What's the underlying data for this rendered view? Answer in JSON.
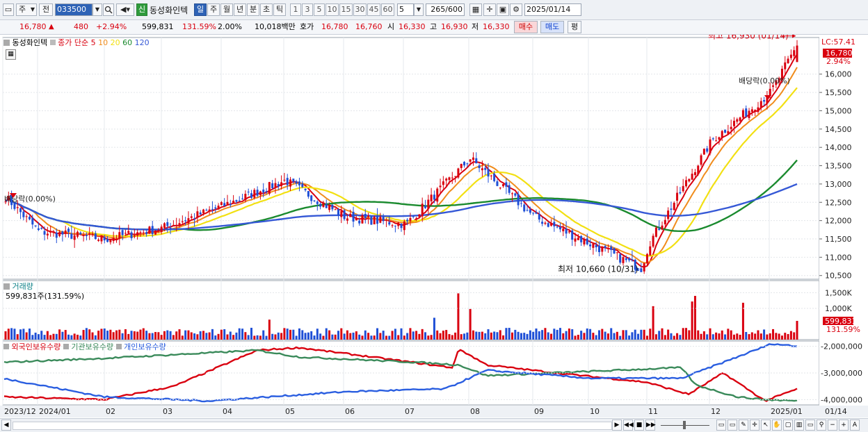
{
  "toolbar": {
    "market_select": "주",
    "prev_label": "전",
    "code": "033500",
    "new_badge": "신",
    "stock_name": "동성화인텍",
    "periods": [
      "일",
      "주",
      "월",
      "년",
      "분",
      "초",
      "틱"
    ],
    "active_period": "일",
    "intervals": [
      "1",
      "3",
      "5",
      "10",
      "15",
      "30",
      "45",
      "60"
    ],
    "interval_value": "5",
    "count_value": "265",
    "count_total": "/600",
    "date": "2025/01/14"
  },
  "quote": {
    "price": "16,780",
    "change_arrow": "▲",
    "change": "480",
    "change_pct": "+2.94%",
    "volume": "599,831",
    "volume_ratio": "131.59%",
    "turnover_pct": "2.00%",
    "amount": "10,018백만",
    "hoga_label": "호가",
    "ask": "16,780",
    "bid": "16,760",
    "open_label": "시",
    "open": "16,330",
    "high_label": "고",
    "high": "16,930",
    "low_label": "저",
    "low": "16,330",
    "buy_button": "매수",
    "sell_button": "매도",
    "eval_button": "평"
  },
  "price_panel": {
    "legend_name": "동성화인텍",
    "legend_ma_title": "종가 단순",
    "legend_ma_periods": [
      "5",
      "10",
      "20",
      "60",
      "120"
    ],
    "top_right_label": "LC:57.41",
    "price_tag": "16,780",
    "pct_tag": "2.94%",
    "max_annotation": "최고 16,930 (01/14)",
    "min_annotation": "최저 10,660 (10/31)",
    "dividend_right": "배당락(0.00%)",
    "dividend_left": "배당락(0.00%)",
    "y_ticks": [
      "16,000",
      "15,500",
      "15,000",
      "14,500",
      "14,000",
      "13,500",
      "13,000",
      "12,500",
      "12,000",
      "11,500",
      "11,000",
      "10,500"
    ]
  },
  "volume_panel": {
    "title": "거래량",
    "value_line": "599,831주(131.59%)",
    "y_ticks": [
      "1,500K",
      "1,000K"
    ],
    "tag_value": "599,831",
    "tag_pct": "131.59%"
  },
  "holdings_panel": {
    "legend": [
      "외국인보유수량",
      "기관보유수량",
      "개인보유수량"
    ],
    "y_ticks": [
      "-2,000,000",
      "-3,000,000",
      "-4,000,000"
    ]
  },
  "x_axis": {
    "labels": [
      "2023/12",
      "2024/01",
      "02",
      "03",
      "04",
      "05",
      "06",
      "07",
      "08",
      "09",
      "10",
      "11",
      "12",
      "2025/01",
      "01/14"
    ]
  },
  "colors": {
    "up": "#d9000f",
    "down": "#1f4fd6",
    "ma5": "#d9000f",
    "ma10": "#f08c1c",
    "ma20": "#f2e012",
    "ma60": "#1a8a2e",
    "ma120": "#3558d6",
    "foreign": "#d9000f",
    "institution": "#3a8a5a",
    "individual": "#2a5ee0"
  },
  "chart_data": {
    "type": "candlestick",
    "period": "daily",
    "price_range": [
      10400,
      17000
    ],
    "anchor_closes": [
      {
        "date": "2023/12",
        "close": 12650
      },
      {
        "date": "2024/01",
        "close": 11700
      },
      {
        "date": "02",
        "close": 11500
      },
      {
        "date": "03",
        "close": 11800
      },
      {
        "date": "04",
        "close": 12400
      },
      {
        "date": "05",
        "close": 13100
      },
      {
        "date": "06",
        "close": 12100
      },
      {
        "date": "07",
        "close": 11900
      },
      {
        "date": "08",
        "close": 13700
      },
      {
        "date": "09",
        "close": 12100
      },
      {
        "date": "10/31",
        "close": 10700
      },
      {
        "date": "11",
        "close": 11400
      },
      {
        "date": "12",
        "close": 14200
      },
      {
        "date": "2025/01",
        "close": 15500
      },
      {
        "date": "01/14",
        "close": 16780
      }
    ],
    "last_bar": {
      "open": 16330,
      "high": 16930,
      "low": 16330,
      "close": 16780,
      "volume": 599831
    },
    "period_high": {
      "value": 16930,
      "date": "01/14"
    },
    "period_low": {
      "value": 10660,
      "date": "10/31"
    },
    "moving_averages": [
      "5",
      "10",
      "20",
      "60",
      "120"
    ],
    "holdings_range": [
      -4200000,
      -1800000
    ],
    "holdings_series_names": [
      "외국인보유수량",
      "기관보유수량",
      "개인보유수량"
    ]
  }
}
